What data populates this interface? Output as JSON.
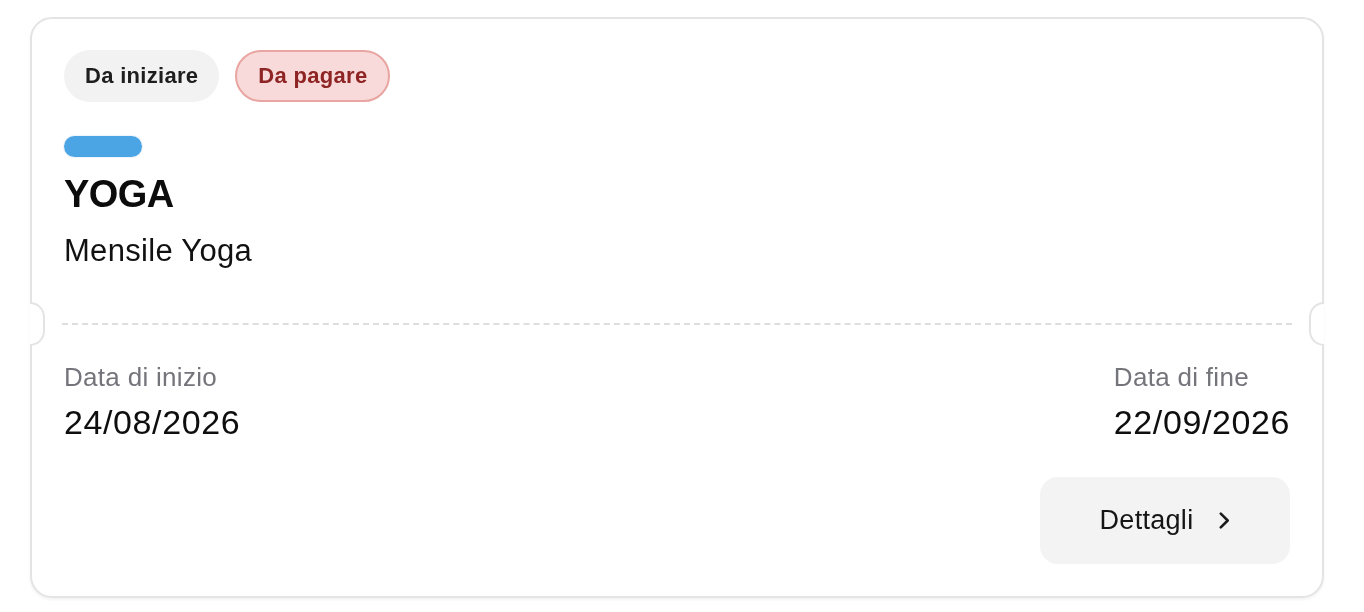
{
  "badges": [
    {
      "label": "Da iniziare",
      "kind": "neutral"
    },
    {
      "label": "Da pagare",
      "kind": "danger"
    }
  ],
  "course": {
    "color": "#4ba4e4",
    "title": "YOGA",
    "subtitle": "Mensile Yoga"
  },
  "dates": [
    {
      "label": "Data di inizio",
      "value": "24/08/2026"
    },
    {
      "label": "Data di fine",
      "value": "22/09/2026"
    }
  ],
  "button": {
    "label": "Dettagli"
  }
}
